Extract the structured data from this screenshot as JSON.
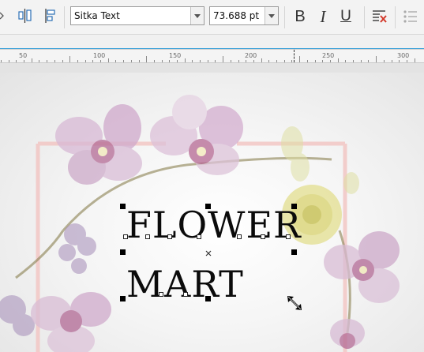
{
  "toolbar": {
    "font_name": "Sitka Text",
    "font_size": "73.688 pt",
    "bold_label": "B",
    "italic_label": "I",
    "underline_label": "U"
  },
  "ruler": {
    "labels": [
      "50",
      "100",
      "150",
      "200",
      "250",
      "300"
    ]
  },
  "artwork": {
    "line1": "FLOWER",
    "line2": "MART",
    "frame_color": "#f2c4c2",
    "petal_color": "#c99ac0",
    "accent_color": "#3fa2d9"
  }
}
